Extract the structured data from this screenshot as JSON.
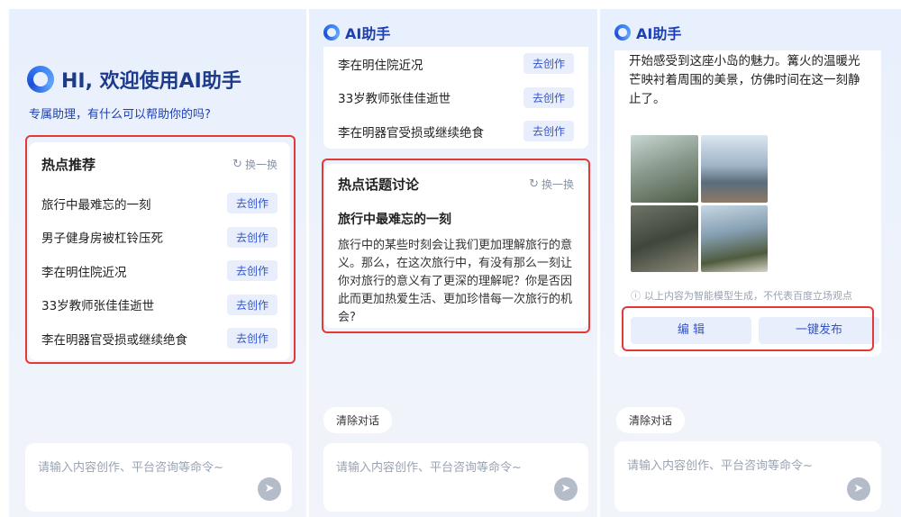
{
  "app": {
    "brand": "AI助手"
  },
  "screen1": {
    "greeting": "HI, 欢迎使用AI助手",
    "subtitle": "专属助理，有什么可以帮助你的吗?",
    "hot": {
      "title": "热点推荐",
      "refresh_label": "换一换",
      "items": [
        {
          "text": "旅行中最难忘的一刻",
          "action": "去创作"
        },
        {
          "text": "男子健身房被杠铃压死",
          "action": "去创作"
        },
        {
          "text": "李在明住院近况",
          "action": "去创作"
        },
        {
          "text": "33岁教师张佳佳逝世",
          "action": "去创作"
        },
        {
          "text": "李在明器官受损或继续绝食",
          "action": "去创作"
        }
      ]
    },
    "input": {
      "placeholder": "请输入内容创作、平台咨询等命令~"
    }
  },
  "screen2": {
    "list": [
      {
        "text": "李在明住院近况",
        "action": "去创作"
      },
      {
        "text": "33岁教师张佳佳逝世",
        "action": "去创作"
      },
      {
        "text": "李在明器官受损或继续绝食",
        "action": "去创作"
      }
    ],
    "topic": {
      "title": "热点话题讨论",
      "refresh_label": "换一换",
      "heading": "旅行中最难忘的一刻",
      "body": "旅行中的某些时刻会让我们更加理解旅行的意义。那么，在这次旅行中，有没有那么一刻让你对旅行的意义有了更深的理解呢？你是否因此而更加热爱生活、更加珍惜每一次旅行的机会?"
    },
    "clear_label": "清除对话",
    "input": {
      "placeholder": "请输入内容创作、平台咨询等命令~"
    }
  },
  "screen3": {
    "article_text": "开始感受到这座小岛的魅力。篝火的温暖光芒映衬着周围的美景，仿佛时间在这一刻静止了。",
    "disclaimer": "以上内容为智能模型生成，不代表百度立场观点",
    "edit_label": "编 辑",
    "publish_label": "一键发布",
    "clear_label": "清除对话",
    "input": {
      "placeholder": "请输入内容创作、平台咨询等命令~"
    }
  },
  "colors": {
    "accent": "#3355cc",
    "highlight_box": "#e53935"
  },
  "icons": [
    "logo-icon",
    "refresh-icon",
    "send-icon",
    "info-icon"
  ]
}
